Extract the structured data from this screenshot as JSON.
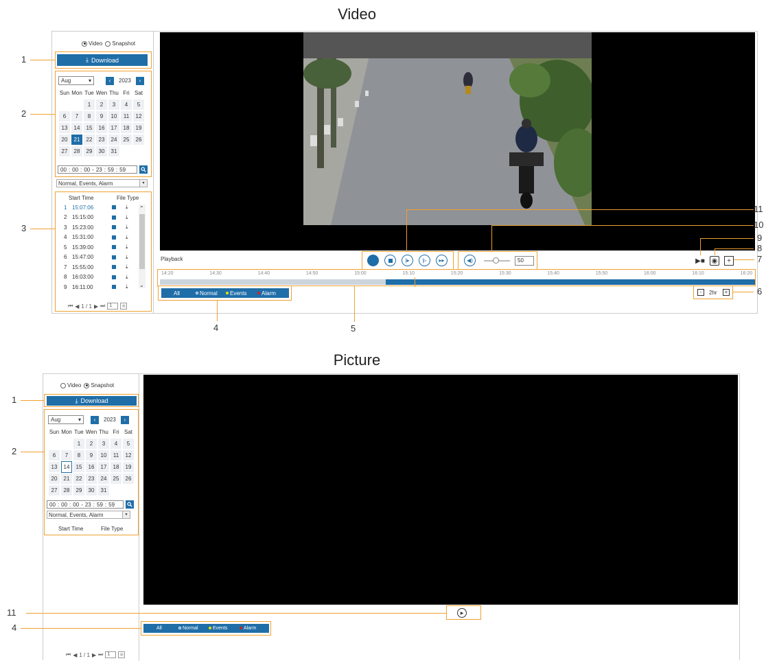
{
  "video_section": {
    "title": "Video",
    "radio_video": "Video",
    "radio_snapshot": "Snapshot",
    "download_label": "Download",
    "month": "Aug",
    "year": "2023",
    "weekdays": [
      "Sun",
      "Mon",
      "Tue",
      "Wen",
      "Thu",
      "Fri",
      "Sat"
    ],
    "days": [
      "",
      "",
      "1",
      "2",
      "3",
      "4",
      "5",
      "6",
      "7",
      "8",
      "9",
      "10",
      "11",
      "12",
      "13",
      "14",
      "15",
      "16",
      "17",
      "18",
      "19",
      "20",
      "21",
      "22",
      "23",
      "24",
      "25",
      "26",
      "27",
      "28",
      "29",
      "30",
      "31"
    ],
    "selected_day": "21",
    "time_start": [
      "00",
      "00",
      "00"
    ],
    "time_end": [
      "23",
      "59",
      "59"
    ],
    "filter": "Normal, Events, Alarm",
    "col_start": "Start Time",
    "col_type": "File Type",
    "files": [
      {
        "idx": "1",
        "time": "15:07:06"
      },
      {
        "idx": "2",
        "time": "15:15:00"
      },
      {
        "idx": "3",
        "time": "15:23:00"
      },
      {
        "idx": "4",
        "time": "15:31:00"
      },
      {
        "idx": "5",
        "time": "15:39:00"
      },
      {
        "idx": "6",
        "time": "15:47:00"
      },
      {
        "idx": "7",
        "time": "15:55:00"
      },
      {
        "idx": "8",
        "time": "16:03:00"
      },
      {
        "idx": "9",
        "time": "16:11:00"
      }
    ],
    "page": "1 / 1",
    "page_input": "1",
    "playback_label": "Playback",
    "volume": "50",
    "timeline_ticks": [
      "14:20",
      "14:30",
      "14:40",
      "14:50",
      "15:00",
      "15:10",
      "15:20",
      "15:30",
      "15:40",
      "15:50",
      "16:00",
      "16:10",
      "16:20"
    ],
    "legend": {
      "all": "All",
      "normal": "Normal",
      "events": "Events",
      "alarm": "Alarm"
    },
    "zoom": "2hr",
    "callouts": [
      "1",
      "2",
      "3",
      "4",
      "5",
      "6",
      "7",
      "8",
      "9",
      "10",
      "11"
    ]
  },
  "picture_section": {
    "title": "Picture",
    "radio_video": "Video",
    "radio_snapshot": "Snapshot",
    "download_label": "Download",
    "month": "Aug",
    "year": "2023",
    "weekdays": [
      "Sun",
      "Mon",
      "Tue",
      "Wen",
      "Thu",
      "Fri",
      "Sat"
    ],
    "days": [
      "",
      "",
      "1",
      "2",
      "3",
      "4",
      "5",
      "6",
      "7",
      "8",
      "9",
      "10",
      "11",
      "12",
      "13",
      "14",
      "15",
      "16",
      "17",
      "18",
      "19",
      "20",
      "21",
      "22",
      "23",
      "24",
      "25",
      "26",
      "27",
      "28",
      "29",
      "30",
      "31"
    ],
    "selected_day": "14",
    "time_start": [
      "00",
      "00",
      "00"
    ],
    "time_end": [
      "23",
      "59",
      "59"
    ],
    "filter": "Normal, Events, Alarm",
    "col_start": "Start Time",
    "col_type": "File Type",
    "page": "1 / 1",
    "page_input": "1",
    "legend": {
      "all": "All",
      "normal": "Normal",
      "events": "Events",
      "alarm": "Alarm"
    },
    "callouts": [
      "1",
      "2",
      "11",
      "4"
    ]
  },
  "colors": {
    "accent": "#1f6ea8",
    "callout": "#f0a030",
    "events": "#e8e000",
    "alarm": "#d02020"
  }
}
